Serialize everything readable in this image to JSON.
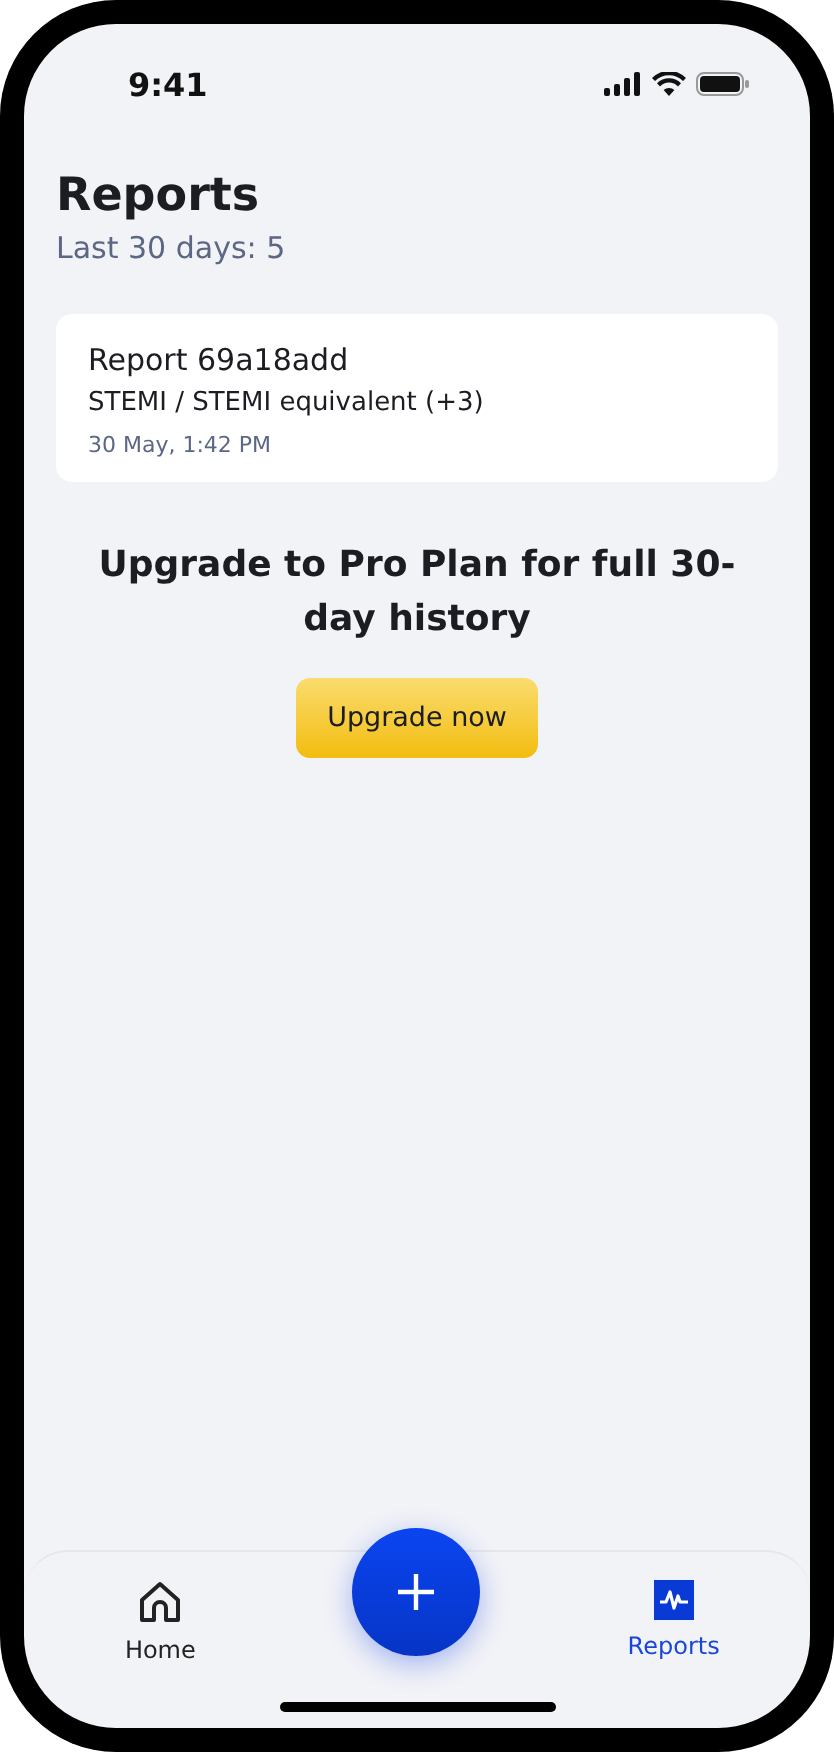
{
  "status_bar": {
    "time": "9:41"
  },
  "header": {
    "title": "Reports",
    "subtitle": "Last 30 days: 5"
  },
  "reports": [
    {
      "title": "Report 69a18add",
      "summary": "STEMI / STEMI equivalent (+3)",
      "date": "30 May, 1:42 PM"
    }
  ],
  "upgrade": {
    "heading": "Upgrade to Pro Plan for full 30-day history",
    "button": "Upgrade now"
  },
  "tab_bar": [
    {
      "kind": "home",
      "label": "Home",
      "selected": false
    },
    {
      "kind": "add"
    },
    {
      "kind": "reports",
      "label": "Reports",
      "selected": true
    }
  ]
}
